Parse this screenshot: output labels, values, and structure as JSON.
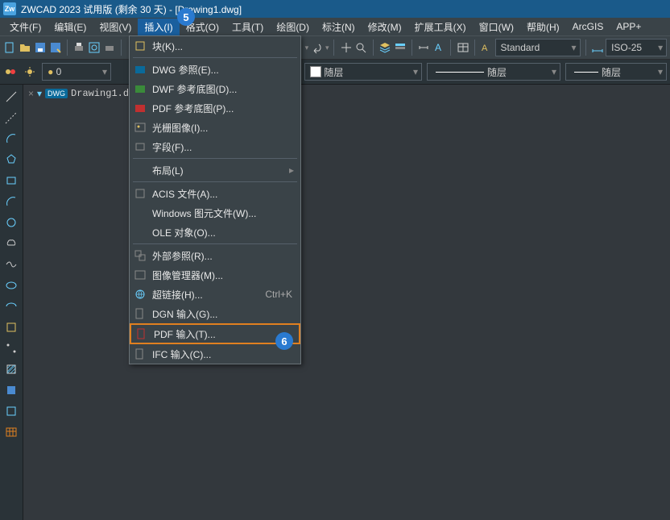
{
  "title": "ZWCAD 2023 试用版 (剩余 30 天) - [Drawing1.dwg]",
  "menubar": {
    "file": "文件(F)",
    "edit": "编辑(E)",
    "view": "视图(V)",
    "insert": "插入(I)",
    "format": "格式(O)",
    "tools": "工具(T)",
    "draw": "绘图(D)",
    "annotate": "标注(N)",
    "modify": "修改(M)",
    "extend": "扩展工具(X)",
    "window": "窗口(W)",
    "help": "帮助(H)",
    "arcgis": "ArcGIS",
    "appplus": "APP+"
  },
  "doc": {
    "filename": "Drawing1.dwg",
    "dwg_badge": "DWG"
  },
  "layerpanel": {
    "bylayer1": "随层",
    "bylayer2": "随层",
    "bylayer3": "随层"
  },
  "style": {
    "standard": "Standard",
    "iso": "ISO-25"
  },
  "menu": {
    "block": "块(K)...",
    "dwg_ref": "DWG 参照(E)...",
    "dwf_underlay": "DWF 参考底图(D)...",
    "pdf_underlay": "PDF 参考底图(P)...",
    "raster": "光栅图像(I)...",
    "field": "字段(F)...",
    "layout": "布局(L)",
    "acis": "ACIS 文件(A)...",
    "wmf": "Windows 图元文件(W)...",
    "ole": "OLE 对象(O)...",
    "xref": "外部参照(R)...",
    "image_mgr": "图像管理器(M)...",
    "hyperlink": "超链接(H)...",
    "hyperlink_sc": "Ctrl+K",
    "dgn": "DGN 输入(G)...",
    "pdf_import": "PDF 输入(T)...",
    "ifc": "IFC 输入(C)..."
  },
  "badges": {
    "b5": "5",
    "b6": "6"
  },
  "icons": {
    "app": "Zw",
    "new": "new-file-icon",
    "open": "open-folder-icon",
    "save": "save-icon",
    "saveall": "save-all-icon",
    "print": "print-icon",
    "plot": "plot-icon",
    "undo": "undo-icon",
    "redo": "redo-icon",
    "pan": "pan-icon",
    "zoom": "zoom-icon",
    "layer": "layer-icon"
  }
}
